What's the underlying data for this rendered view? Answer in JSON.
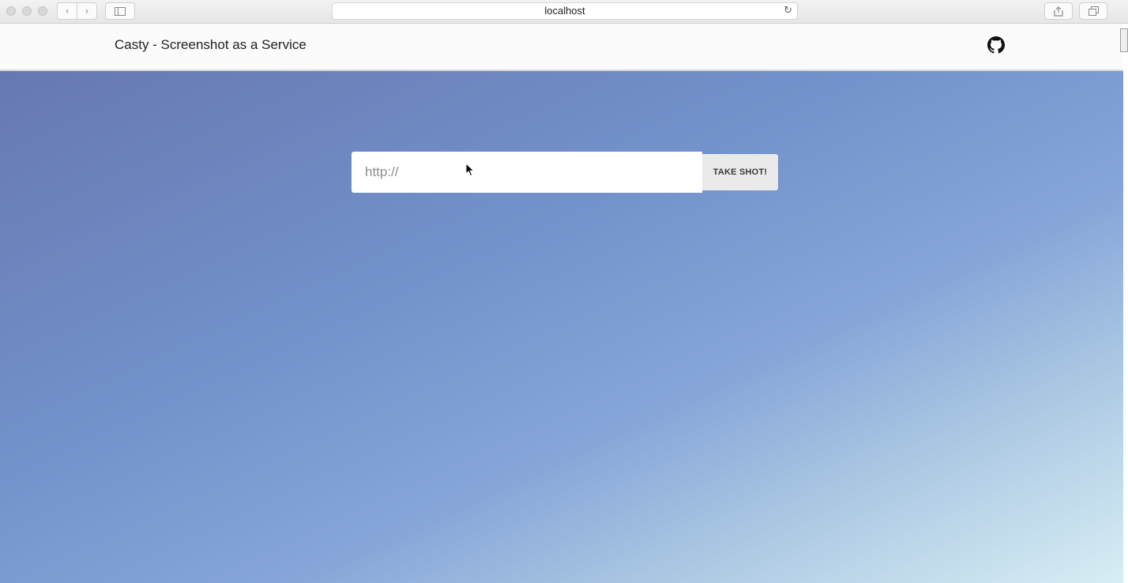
{
  "browser": {
    "url": "localhost",
    "back_glyph": "‹",
    "forward_glyph": "›",
    "reload_glyph": "↻"
  },
  "header": {
    "brand": "Casty - Screenshot as a Service",
    "github_icon": "github-icon"
  },
  "form": {
    "url_placeholder": "http://",
    "url_value": "",
    "submit_label": "TAKE SHOT!"
  },
  "colors": {
    "header_bg": "#fbfbfb",
    "button_bg": "#eaeaea",
    "gradient_start": "#6778b0",
    "gradient_end": "#d8eef5"
  }
}
